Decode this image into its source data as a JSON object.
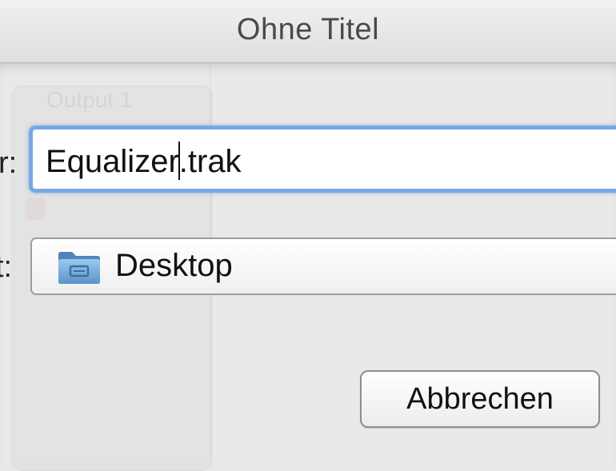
{
  "window": {
    "title": "Ohne Titel"
  },
  "dialog": {
    "name_label": "r:",
    "name_value_before_caret": "Equalizer",
    "name_value_after_caret": ".trak",
    "location_label": "t:",
    "location_value": "Desktop",
    "location_icon": "folder-icon",
    "cancel_label": "Abbrechen"
  },
  "background": {
    "ghost_label": "Output 1"
  },
  "colors": {
    "focus_ring": "#7aa7e4",
    "folder": "#6aa6d8"
  }
}
